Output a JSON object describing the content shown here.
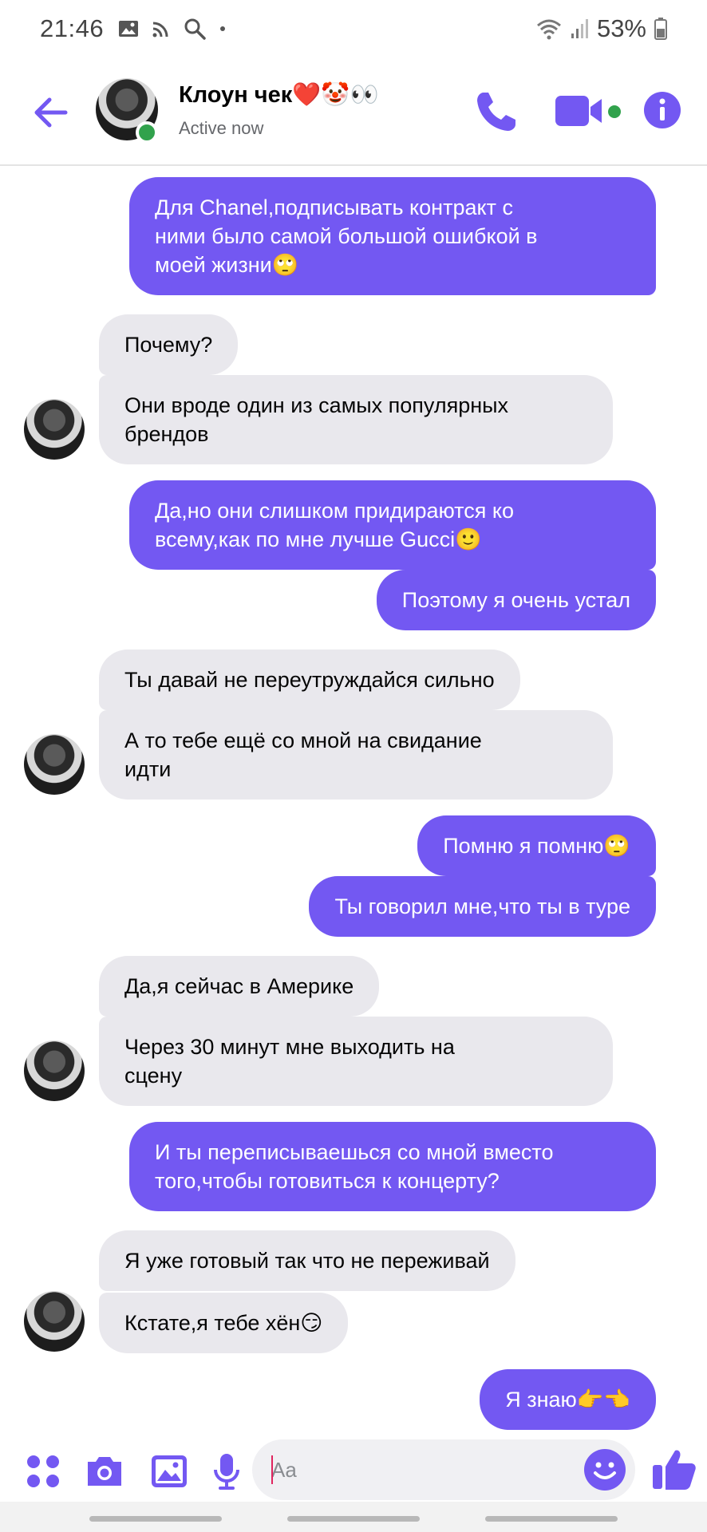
{
  "status_bar": {
    "time": "21:46",
    "battery": "53%",
    "icons": [
      "image-icon",
      "cast-icon",
      "search-icon",
      "dot-icon",
      "wifi-icon",
      "signal-icon",
      "battery-icon"
    ]
  },
  "header": {
    "contact_name": "Клоун чек❤️🤡👀",
    "contact_status": "Active now",
    "accent_color": "#7358f2",
    "online_color": "#31a24c"
  },
  "messages": [
    {
      "side": "out",
      "text": "Для Chanel,подписывать контракт с\nними было самой большой ошибкой в\nмоей жизни🙄"
    },
    {
      "side": "in",
      "text": "Почему?"
    },
    {
      "side": "in",
      "text": "Они вроде один из самых популярных\nбрендов"
    },
    {
      "side": "out",
      "text": "Да,но они слишком придираются ко\nвсему,как по мне лучше Gucci🙂"
    },
    {
      "side": "out",
      "text": "Поэтому я очень устал"
    },
    {
      "side": "in",
      "text": "Ты давай не переутруждайся сильно"
    },
    {
      "side": "in",
      "text": "А то тебе ещё со мной на свидание\nидти"
    },
    {
      "side": "out",
      "text": "Помню я помню🙄"
    },
    {
      "side": "out",
      "text": "Ты говорил мне,что ты в туре"
    },
    {
      "side": "in",
      "text": "Да,я сейчас в Америке"
    },
    {
      "side": "in",
      "text": "Через 30 минут мне выходить на\nсцену"
    },
    {
      "side": "out",
      "text": "И ты переписываешься со мной вместо\nтого,чтобы готовиться к концерту?"
    },
    {
      "side": "in",
      "text": "Я уже готовый так что не переживай"
    },
    {
      "side": "in",
      "text": "Кстате,я тебе хён😏"
    },
    {
      "side": "out",
      "text": "Я знаю👉👈"
    }
  ],
  "composer": {
    "placeholder": "Aa",
    "value": ""
  }
}
